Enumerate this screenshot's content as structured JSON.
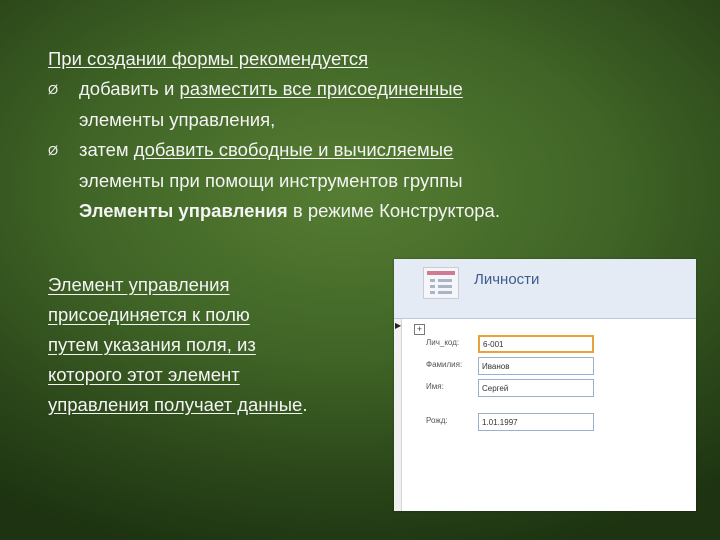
{
  "slide": {
    "intro": "При создании формы рекомендуется",
    "bullet1_line1_plain": "добавить и ",
    "bullet1_line1_link": "разместить все присоединенные",
    "bullet1_line2": "элементы управления,",
    "bullet2_line1_plain": "затем ",
    "bullet2_line1_link": "добавить свободные и вычисляемые",
    "bullet2_line2": "элементы при помощи инструментов группы",
    "bullet2_line3_bold": "Элементы управления",
    "bullet2_line3_rest": " в режиме Конструктора.",
    "bullet_symbol": "Ø",
    "left_lines": [
      "Элемент управления",
      "присоединяется к полю",
      "путем указания поля, из",
      "которого этот элемент",
      "управления получает данные"
    ],
    "left_end": "."
  },
  "form": {
    "title": "Личности",
    "fields": [
      {
        "label": "Лич_код:",
        "value": "6-001"
      },
      {
        "label": "Фамилия:",
        "value": "Иванов"
      },
      {
        "label": "Имя:",
        "value": "Сергей"
      },
      {
        "label": "Рожд:",
        "value": "1.01.1997"
      }
    ]
  }
}
